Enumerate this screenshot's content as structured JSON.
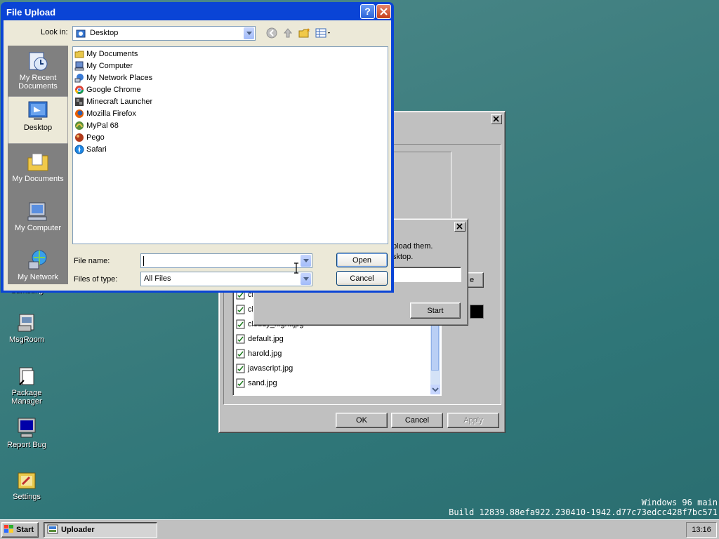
{
  "desktop": {
    "icons": [
      {
        "label": "Samsung"
      },
      {
        "label": "MsgRoom"
      },
      {
        "label": "Package Manager"
      },
      {
        "label": "Report Bug"
      },
      {
        "label": "Settings"
      }
    ],
    "watermark": {
      "line1": "Windows 96 main",
      "line2": "Build 12839.88efa922.230410-1942.d77c73edcc428f7bc571"
    }
  },
  "taskbar": {
    "start_label": "Start",
    "task_label": "Uploader",
    "clock": "13:16"
  },
  "uploader_window": {
    "files": [
      "cl",
      "cl",
      "cloudy_night.jpg",
      "default.jpg",
      "harold.jpg",
      "javascript.jpg",
      "sand.jpg"
    ],
    "ok_label": "OK",
    "cancel_label": "Cancel",
    "apply_label": "Apply",
    "browse_label_partial": "e"
  },
  "uploader_prompt": {
    "text1": "pload them.",
    "text2": "sktop.",
    "start_label": "Start"
  },
  "file_upload": {
    "title": "File Upload",
    "look_in_label": "Look in:",
    "look_in_value": "Desktop",
    "places": [
      {
        "label": "My Recent Documents",
        "icon": "recent-documents-icon"
      },
      {
        "label": "Desktop",
        "icon": "desktop-icon"
      },
      {
        "label": "My Documents",
        "icon": "my-documents-icon"
      },
      {
        "label": "My Computer",
        "icon": "my-computer-icon"
      },
      {
        "label": "My Network",
        "icon": "my-network-icon"
      }
    ],
    "items": [
      {
        "label": "My Documents",
        "color": "#e8c74a"
      },
      {
        "label": "My Computer",
        "color": "#6b8fcf"
      },
      {
        "label": "My Network Places",
        "color": "#3a7bd5"
      },
      {
        "label": "Google Chrome",
        "color": "#db4437"
      },
      {
        "label": "Minecraft Launcher",
        "color": "#3d3d3d"
      },
      {
        "label": "Mozilla Firefox",
        "color": "#e66000"
      },
      {
        "label": "MyPal 68",
        "color": "#5a8f3a"
      },
      {
        "label": "Pego",
        "color": "#b03a1a"
      },
      {
        "label": "Safari",
        "color": "#1e88e5"
      }
    ],
    "file_name_label": "File name:",
    "file_name_value": "",
    "files_of_type_label": "Files of type:",
    "files_of_type_value": "All Files",
    "open_label": "Open",
    "cancel_label": "Cancel"
  }
}
